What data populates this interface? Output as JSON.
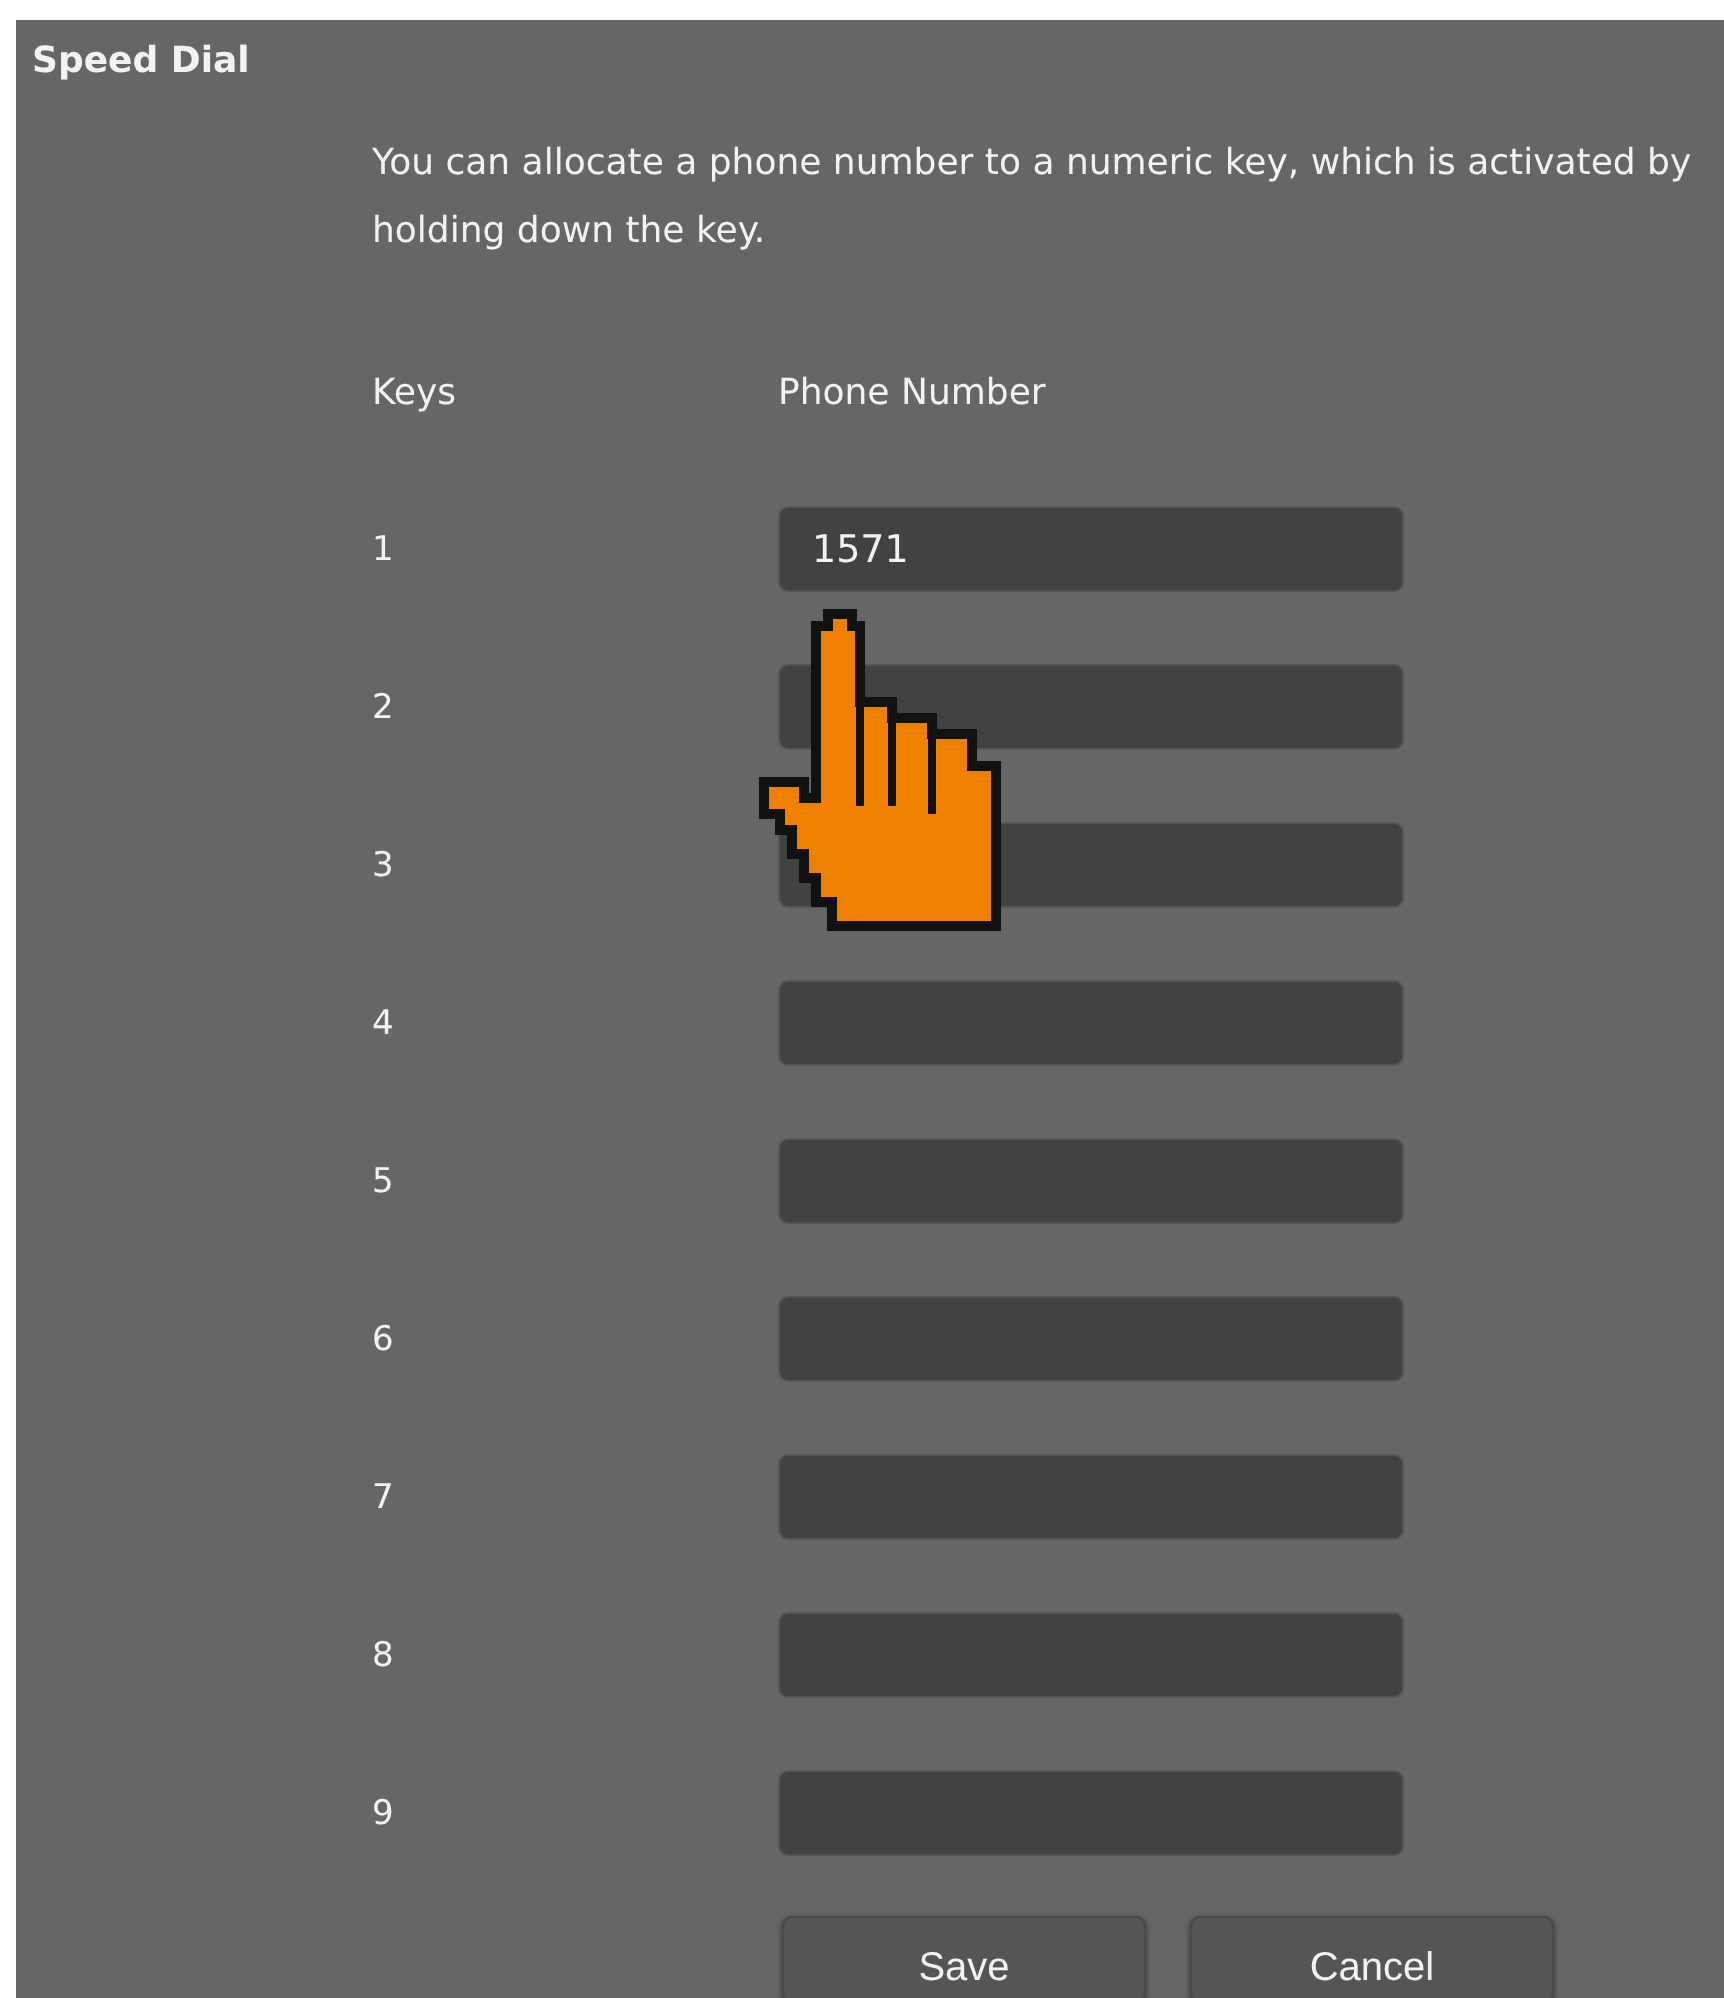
{
  "title": "Speed Dial",
  "description": "You can allocate a phone number to a numeric key, which is activated by holding down the key.",
  "columns": [
    "Keys",
    "Phone Number"
  ],
  "rows": [
    {
      "key": "1",
      "phone_number": "1571"
    },
    {
      "key": "2"
    },
    {
      "key": "3"
    },
    {
      "key": "4"
    },
    {
      "key": "5"
    },
    {
      "key": "6"
    },
    {
      "key": "7"
    },
    {
      "key": "8"
    },
    {
      "key": "9"
    }
  ],
  "buttons": [
    "Save",
    "Cancel"
  ]
}
